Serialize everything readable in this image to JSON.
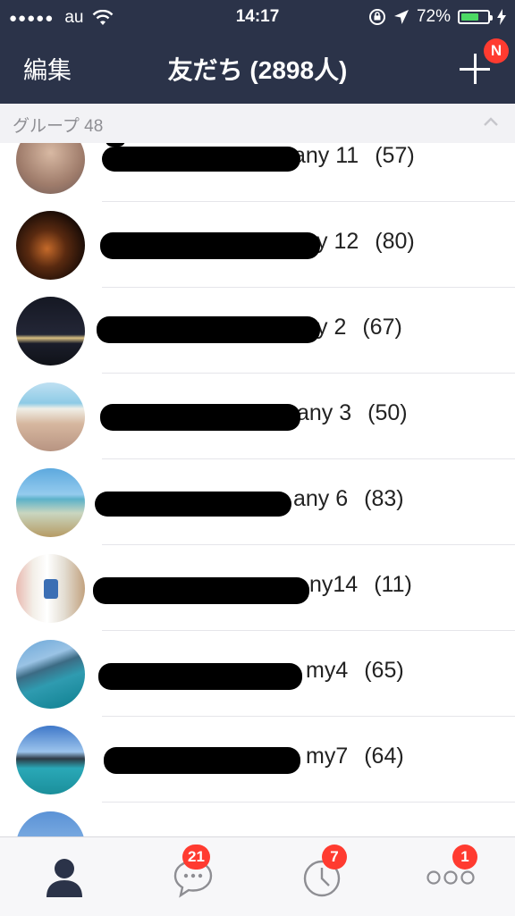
{
  "status_bar": {
    "signal_dots": "●●●●●",
    "carrier": "au",
    "time": "14:17",
    "battery_percent": "72%",
    "battery_level": 0.72,
    "battery_color": "#4cd964"
  },
  "nav": {
    "left_label": "編集",
    "title": "友だち (2898人)",
    "add_badge": "N",
    "bar_color": "#2b3349"
  },
  "section": {
    "label": "グループ 48"
  },
  "groups": [
    {
      "name_suffix": "any 11",
      "count": "(57)"
    },
    {
      "name_suffix": "y 12",
      "count": "(80)"
    },
    {
      "name_suffix": "y 2",
      "count": "(67)"
    },
    {
      "name_suffix": "any 3",
      "count": "(50)"
    },
    {
      "name_suffix": "any 6",
      "count": "(83)"
    },
    {
      "name_suffix": "ny14",
      "count": "(11)"
    },
    {
      "name_suffix": "my4",
      "count": "(65)"
    },
    {
      "name_suffix": "my7",
      "count": "(64)"
    }
  ],
  "tabs": {
    "friends_icon": "person-icon",
    "chats_badge": "21",
    "timeline_badge": "7",
    "more_badge": "1",
    "active_color": "#2b3349",
    "badge_color": "#ff3b30"
  }
}
